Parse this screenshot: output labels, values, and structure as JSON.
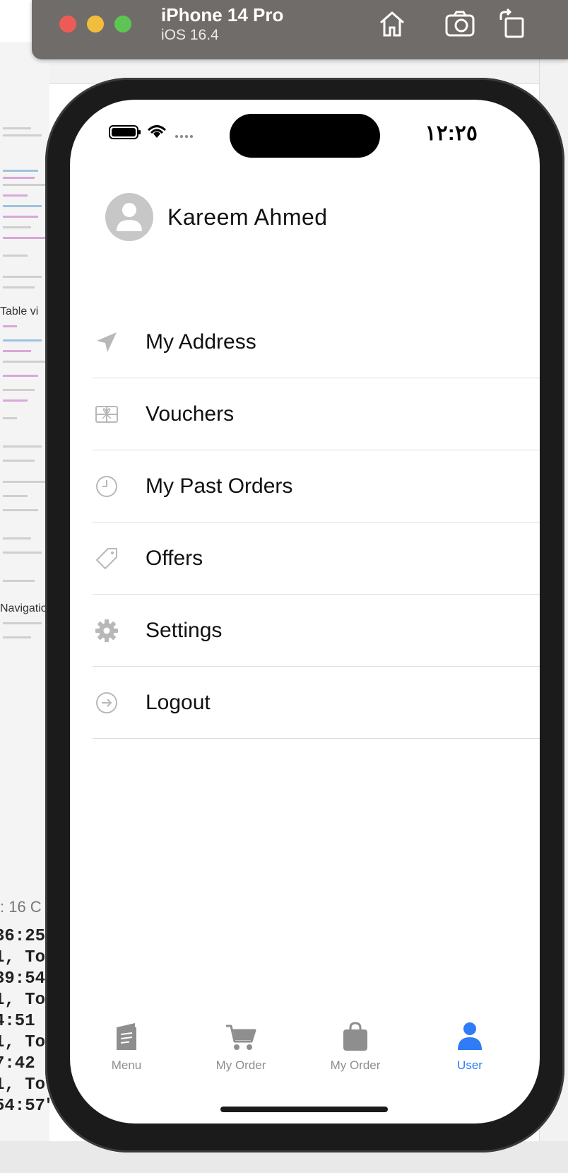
{
  "simulator": {
    "device_name": "iPhone 14 Pro",
    "os_version": "iOS 16.4",
    "buttons": [
      "home-icon",
      "screenshot-icon",
      "rotate-icon"
    ]
  },
  "background_ide": {
    "labels": [
      "Table vi",
      "Navigatio"
    ],
    "console_header": ": 16  C",
    "console_lines": [
      "36:25",
      "1, To",
      "39:54",
      "1, To",
      "4:51",
      "1, To",
      "7:42",
      "1, To",
      "54:57\")"
    ]
  },
  "status_bar": {
    "time": "١٢:٢٥"
  },
  "profile": {
    "name": "Kareem Ahmed",
    "icon": "person-icon"
  },
  "menu": {
    "items": [
      {
        "label": "My Address",
        "icon": "location-arrow-icon"
      },
      {
        "label": "Vouchers",
        "icon": "gift-card-icon"
      },
      {
        "label": "My Past Orders",
        "icon": "clock-icon"
      },
      {
        "label": "Offers",
        "icon": "tag-icon"
      },
      {
        "label": "Settings",
        "icon": "gear-icon"
      },
      {
        "label": "Logout",
        "icon": "logout-arrow-icon"
      }
    ]
  },
  "tabbar": {
    "tabs": [
      {
        "label": "Menu",
        "icon": "book-icon",
        "active": false
      },
      {
        "label": "My Order",
        "icon": "cart-icon",
        "active": false
      },
      {
        "label": "My Order",
        "icon": "bag-icon",
        "active": false
      },
      {
        "label": "User",
        "icon": "person-icon",
        "active": true
      }
    ]
  },
  "colors": {
    "accent": "#2f7cf6",
    "inactive_tab": "#8e8e8e",
    "menu_icon": "#b8b8b8",
    "avatar_bg": "#c7c7c7"
  }
}
